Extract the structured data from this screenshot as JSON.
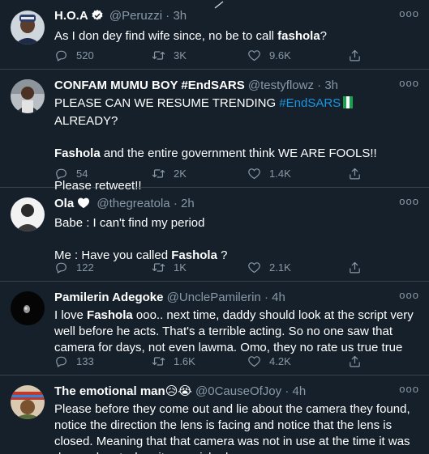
{
  "tweets": [
    {
      "name": "H.O.A",
      "handle": "@Peruzzi",
      "time": "3h",
      "verified": true,
      "text_before": "As I don dey find wife since, no be to call ",
      "text_hl": "fashola",
      "text_after": "?",
      "replies": "520",
      "retweets": "3K",
      "likes": "9.6K"
    },
    {
      "name": "CONFAM MUMU BOY #EndSARS",
      "handle": "@testyflowz",
      "time": "3h",
      "line1_before": "PLEASE CAN WE RESUME TRENDING ",
      "line1_hashtag": "#EndSARS",
      "line1_after": " ALREADY?",
      "line2_hl": "Fashola",
      "line2_rest": " and the entire government think WE ARE FOOLS!!",
      "line3": "Please retweet!!",
      "replies": "54",
      "retweets": "2K",
      "likes": "1.4K"
    },
    {
      "name": "Ola",
      "handle": "@thegreatola",
      "time": "2h",
      "line1": "Babe : I can't find my period",
      "line2_before": "Me : Have you called ",
      "line2_hl": "Fashola",
      "line2_after": " ?",
      "replies": "122",
      "retweets": "1K",
      "likes": "2.1K"
    },
    {
      "name": "Pamilerin Adegoke",
      "handle": "@UnclePamilerin",
      "time": "4h",
      "text_before": "I love ",
      "text_hl": "Fashola",
      "text_after": " ooo.. next time, daddy should look at the script very well before he acts. That's a terrible acting. So no one saw that camera for days, not even lawma. Omo, they no rate us true true",
      "replies": "133",
      "retweets": "1.6K",
      "likes": "4.2K"
    },
    {
      "name": "The emotional man",
      "name_emoji": "😥😭",
      "handle": "@0CauseOfJoy",
      "time": "4h",
      "text": "Please before they come out and lie about the camera they found, notice the direction the lens is facing and notice that the lens is closed. Meaning that that camera was not in use at the time it was dropped, not when it was picked"
    }
  ],
  "icons": {
    "reply": "reply-icon",
    "retweet": "retweet-icon",
    "like": "heart-icon",
    "share": "share-icon",
    "more": "more-icon",
    "verified": "verified-badge-icon"
  },
  "colors": {
    "background": "#15202b",
    "divider": "#38444d",
    "secondary_text": "#8899a6",
    "link": "#1b95e0"
  },
  "sep": "·",
  "more_dots": "ooo"
}
